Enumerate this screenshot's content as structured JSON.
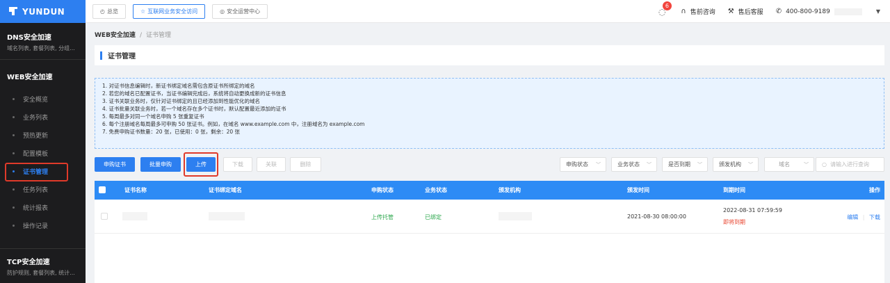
{
  "brand": {
    "name": "YUNDUN",
    "color": "#2d7ff0"
  },
  "sidebar": {
    "dns": {
      "title": "DNS安全加速",
      "subtitle": "域名列表, 套餐列表, 分组..."
    },
    "web_title": "WEB安全加速",
    "items": [
      {
        "label": "安全概览"
      },
      {
        "label": "业务列表"
      },
      {
        "label": "预热更新"
      },
      {
        "label": "配置模板"
      },
      {
        "label": "证书管理",
        "active": true
      },
      {
        "label": "任务列表"
      },
      {
        "label": "统计报表"
      },
      {
        "label": "操作记录"
      }
    ],
    "tcp": {
      "title": "TCP安全加速",
      "subtitle": "防护规则, 套餐列表, 统计..."
    }
  },
  "topbar": {
    "tabs": [
      {
        "label": "总览",
        "icon": "dashboard-icon"
      },
      {
        "label": "互联网业务安全访问",
        "icon": "shield-icon",
        "active": true
      },
      {
        "label": "安全运营中心",
        "icon": "target-icon"
      }
    ],
    "notification_count": "6",
    "presale": "售前咨询",
    "aftersale": "售后客服",
    "phone": "400-800-9189"
  },
  "breadcrumb": {
    "parent": "WEB安全加速",
    "current": "证书管理"
  },
  "page_title": "证书管理",
  "notice": [
    "1. 对证书信息编辑时，新证书绑定域名需包含原证书所绑定的域名",
    "2. 若您的域名已配置证书，当证书编辑完成后，系统将自动更换成新的证书信息",
    "3. 证书关联业务时，仅针对证书绑定的且已经添加到性能优化的域名",
    "4. 证书批量关联业务时，若一个域名存在多个证书时，默认配置最近添加的证书",
    "5. 每周最多对同一个域名申购 5 张重复证书",
    "6. 每个注册域名每周最多可申购 50 张证书。例如，在域名 www.example.com 中，注册域名为 example.com",
    "7. 免费申购证书数量：20 张，已使用：0 张，剩余：20 张"
  ],
  "toolbar": {
    "apply": "申购证书",
    "batch_apply": "批量申购",
    "upload": "上传",
    "download": "下载",
    "associate": "关联",
    "delete": "删除",
    "filters": [
      "申购状态",
      "业务状态",
      "是否到期",
      "颁发机构",
      "域名"
    ],
    "search_placeholder": "请输入进行查询"
  },
  "table": {
    "headers": [
      "证书名称",
      "证书绑定域名",
      "申购状态",
      "业务状态",
      "颁发机构",
      "颁发时间",
      "到期时间",
      "操作"
    ],
    "rows": [
      {
        "apply_status": "上传托管",
        "biz_status": "已绑定",
        "issue_time": "2021-08-30 08:00:00",
        "expire_time": "2022-08-31 07:59:59",
        "expire_note": "即将到期",
        "edit": "编辑",
        "download": "下载"
      }
    ]
  },
  "colors": {
    "primary": "#2d7ff0",
    "success": "#2fa84f",
    "danger": "#e8432e",
    "highlight": "#e03a2a"
  }
}
